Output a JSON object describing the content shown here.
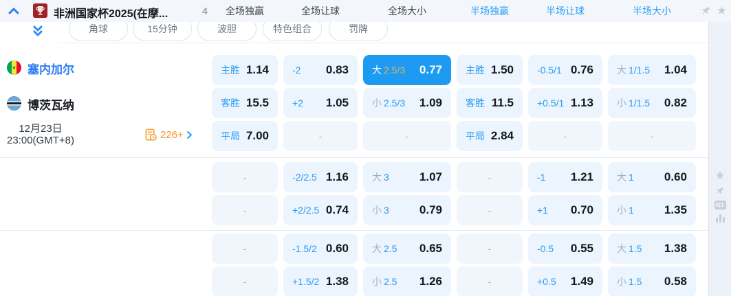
{
  "league": {
    "title": "非洲国家杯2025(在摩...",
    "count": "4",
    "markets": [
      {
        "label": "全场独赢",
        "scope": "full"
      },
      {
        "label": "全场让球",
        "scope": "full"
      },
      {
        "label": "全场大小",
        "scope": "full"
      },
      {
        "label": "半场独赢",
        "scope": "half"
      },
      {
        "label": "半场让球",
        "scope": "half"
      },
      {
        "label": "半场大小",
        "scope": "half"
      }
    ]
  },
  "subnav": {
    "pills": [
      "角球",
      "15分钟",
      "波胆",
      "特色组合",
      "罚牌"
    ]
  },
  "match": {
    "home_team": "塞内加尔",
    "away_team": "博茨瓦纳",
    "date": "12月23日",
    "time": "23:00(GMT+8)",
    "more_odds_count": "226+"
  },
  "icons": {
    "zero_one_label": "0|1",
    "favorite_star": "★"
  },
  "colors": {
    "accent_blue": "#1d9bf2",
    "link_blue": "#2b9cf6",
    "cell_bg": "#ecf4fd",
    "highlight_gold": "#d8b164",
    "orange": "#f7982f",
    "header_bg": "#f3f7fc"
  },
  "odds": {
    "groups": [
      {
        "rows": [
          [
            {
              "l": "主胜",
              "o": "1.14"
            },
            {
              "l": "-2",
              "o": "0.83"
            },
            {
              "p": "大",
              "l": "2.5/3",
              "o": "0.77",
              "hl": true
            },
            {
              "l": "主胜",
              "o": "1.50"
            },
            {
              "l": "-0.5/1",
              "o": "0.76"
            },
            {
              "p": "大",
              "l": "1/1.5",
              "o": "1.04"
            }
          ],
          [
            {
              "l": "客胜",
              "o": "15.5"
            },
            {
              "l": "+2",
              "o": "1.05"
            },
            {
              "p": "小",
              "l": "2.5/3",
              "o": "1.09"
            },
            {
              "l": "客胜",
              "o": "11.5"
            },
            {
              "l": "+0.5/1",
              "o": "1.13"
            },
            {
              "p": "小",
              "l": "1/1.5",
              "o": "0.82"
            }
          ],
          [
            {
              "l": "平局",
              "o": "7.00"
            },
            {
              "dash": true
            },
            {
              "dash": true
            },
            {
              "l": "平局",
              "o": "2.84"
            },
            {
              "dash": true
            },
            {
              "dash": true
            }
          ]
        ]
      },
      {
        "rows": [
          [
            {
              "dash": true
            },
            {
              "l": "-2/2.5",
              "o": "1.16"
            },
            {
              "p": "大",
              "l": "3",
              "o": "1.07"
            },
            {
              "dash": true
            },
            {
              "l": "-1",
              "o": "1.21"
            },
            {
              "p": "大",
              "l": "1",
              "o": "0.60"
            }
          ],
          [
            {
              "dash": true
            },
            {
              "l": "+2/2.5",
              "o": "0.74"
            },
            {
              "p": "小",
              "l": "3",
              "o": "0.79"
            },
            {
              "dash": true
            },
            {
              "l": "+1",
              "o": "0.70"
            },
            {
              "p": "小",
              "l": "1",
              "o": "1.35"
            }
          ]
        ]
      },
      {
        "rows": [
          [
            {
              "dash": true
            },
            {
              "l": "-1.5/2",
              "o": "0.60"
            },
            {
              "p": "大",
              "l": "2.5",
              "o": "0.65"
            },
            {
              "dash": true
            },
            {
              "l": "-0.5",
              "o": "0.55"
            },
            {
              "p": "大",
              "l": "1.5",
              "o": "1.38"
            }
          ],
          [
            {
              "dash": true
            },
            {
              "l": "+1.5/2",
              "o": "1.38"
            },
            {
              "p": "小",
              "l": "2.5",
              "o": "1.26"
            },
            {
              "dash": true
            },
            {
              "l": "+0.5",
              "o": "1.49"
            },
            {
              "p": "小",
              "l": "1.5",
              "o": "0.58"
            }
          ]
        ]
      }
    ]
  }
}
